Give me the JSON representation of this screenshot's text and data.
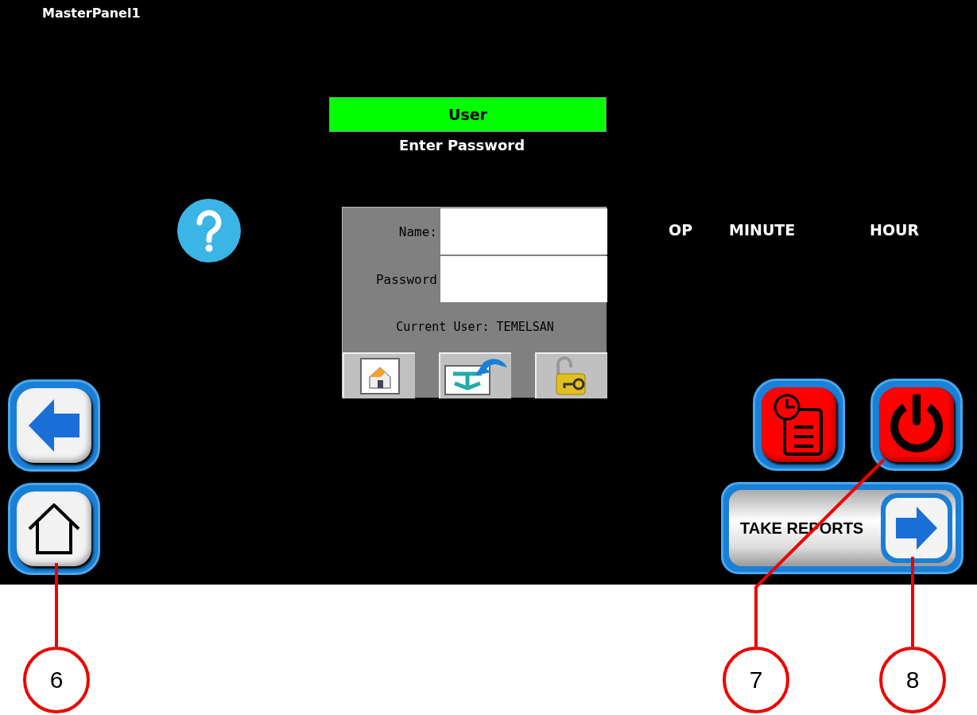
{
  "panel_title": "MasterPanel1",
  "header": {
    "title": "User",
    "subtitle": "Enter Password"
  },
  "login": {
    "fields": [
      {
        "label": "Name:"
      },
      {
        "label": "Password"
      }
    ],
    "current_user": "Current User: TEMELSAN",
    "tools": [
      {
        "kind": "home"
      },
      {
        "kind": "exit"
      },
      {
        "kind": "unlock"
      }
    ]
  },
  "column_labels": [
    "OP",
    "MINUTE",
    "HOUR"
  ],
  "nav_buttons": [
    {
      "kind": "back"
    },
    {
      "kind": "home"
    }
  ],
  "action_buttons": [
    {
      "kind": "schedule"
    },
    {
      "kind": "power"
    }
  ],
  "report_button": {
    "label": "TAKE REPORTS"
  },
  "callouts": [
    {
      "number": "6",
      "kind": "home"
    },
    {
      "number": "7",
      "kind": "power"
    },
    {
      "number": "8",
      "kind": "report"
    }
  ]
}
